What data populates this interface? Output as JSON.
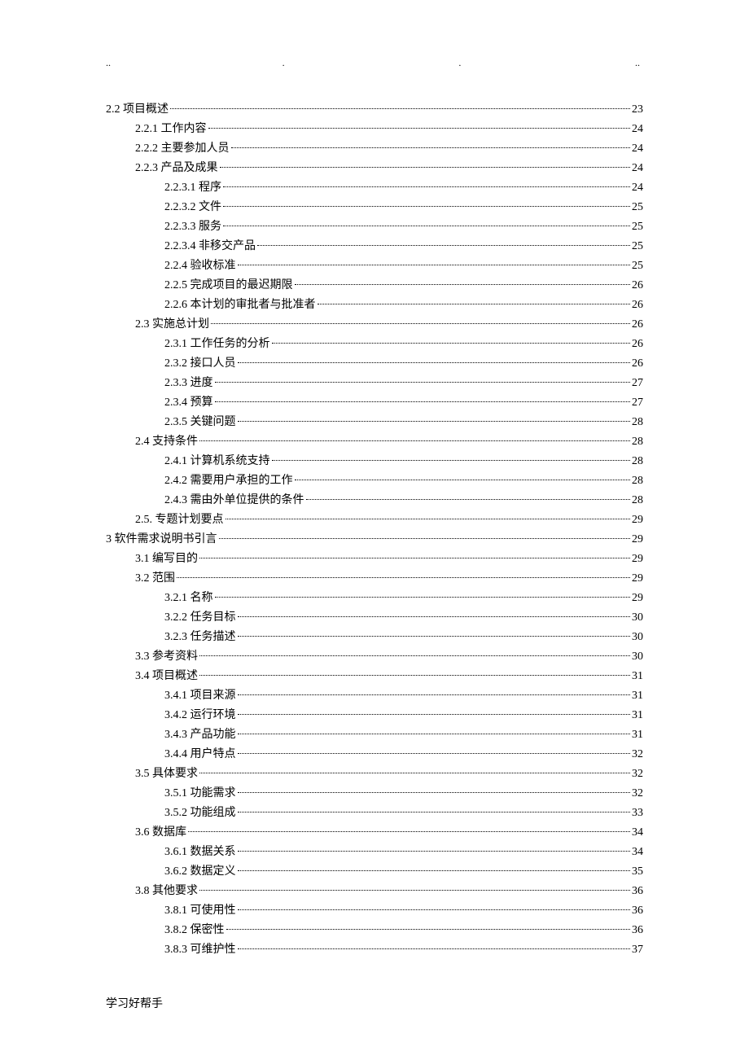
{
  "header_dots": [
    "..",
    ".",
    ".",
    ".."
  ],
  "footer": "学习好帮手",
  "toc": [
    {
      "indent": 0,
      "label": "2.2 项目概述",
      "page": "23"
    },
    {
      "indent": 1,
      "label": "2.2.1 工作内容",
      "page": "24"
    },
    {
      "indent": 1,
      "label": "2.2.2 主要参加人员",
      "page": "24"
    },
    {
      "indent": 1,
      "label": "2.2.3 产品及成果",
      "page": "24"
    },
    {
      "indent": 2,
      "label": "2.2.3.1  程序",
      "page": "24"
    },
    {
      "indent": 2,
      "label": "2.2.3.2  文件",
      "page": "25"
    },
    {
      "indent": 2,
      "label": "2.2.3.3  服务",
      "page": "25"
    },
    {
      "indent": 2,
      "label": "2.2.3.4  非移交产品",
      "page": "25"
    },
    {
      "indent": 2,
      "label": "2.2.4 验收标准",
      "page": "25"
    },
    {
      "indent": 2,
      "label": "2.2.5  完成项目的最迟期限",
      "page": "26"
    },
    {
      "indent": 2,
      "label": "2.2.6  本计划的审批者与批准者",
      "page": "26"
    },
    {
      "indent": 1,
      "label": "2.3 实施总计划",
      "page": "26"
    },
    {
      "indent": 2,
      "label": "2.3.1  工作任务的分析",
      "page": "26"
    },
    {
      "indent": 2,
      "label": "2.3.2  接口人员",
      "page": "26"
    },
    {
      "indent": 2,
      "label": "2.3.3  进度",
      "page": "27"
    },
    {
      "indent": 2,
      "label": "2.3.4  预算",
      "page": "27"
    },
    {
      "indent": 2,
      "label": "2.3.5 关键问题",
      "page": "28"
    },
    {
      "indent": 1,
      "label": "2.4 支持条件",
      "page": "28"
    },
    {
      "indent": 2,
      "label": "2.4.1 计算机系统支持",
      "page": "28"
    },
    {
      "indent": 2,
      "label": "2.4.2  需要用户承担的工作",
      "page": "28"
    },
    {
      "indent": 2,
      "label": "2.4.3  需由外单位提供的条件",
      "page": "28"
    },
    {
      "indent": 1,
      "label": "2.5.  专题计划要点",
      "page": "29"
    },
    {
      "indent": 0,
      "label": "3 软件需求说明书引言",
      "page": "29"
    },
    {
      "indent": 1,
      "label": "3.1 编写目的",
      "page": "29"
    },
    {
      "indent": 1,
      "label": "3.2 范围",
      "page": "29"
    },
    {
      "indent": 2,
      "label": "3.2.1    名称",
      "page": "29"
    },
    {
      "indent": 2,
      "label": "3.2.2    任务目标",
      "page": "30"
    },
    {
      "indent": 2,
      "label": "3.2.3    任务描述",
      "page": "30"
    },
    {
      "indent": 1,
      "label": "3.3 参考资料",
      "page": "30"
    },
    {
      "indent": 1,
      "label": "3.4 项目概述",
      "page": "31"
    },
    {
      "indent": 2,
      "label": "3.4.1 项目来源",
      "page": "31"
    },
    {
      "indent": 2,
      "label": "3.4.2 运行环境",
      "page": "31"
    },
    {
      "indent": 2,
      "label": "3.4.3 产品功能",
      "page": "31"
    },
    {
      "indent": 2,
      "label": "3.4.4 用户特点",
      "page": "32"
    },
    {
      "indent": 1,
      "label": "3.5 具体要求",
      "page": "32"
    },
    {
      "indent": 2,
      "label": "3.5.1 功能需求",
      "page": "32"
    },
    {
      "indent": 2,
      "label": "3.5.2   功能组成",
      "page": "33"
    },
    {
      "indent": 1,
      "label": "3.6 数据库",
      "page": "34"
    },
    {
      "indent": 2,
      "label": "3.6.1   数据关系",
      "page": "34"
    },
    {
      "indent": 2,
      "label": "3.6.2   数据定义",
      "page": "35"
    },
    {
      "indent": 1,
      "label": "3.8 其他要求",
      "page": "36"
    },
    {
      "indent": 2,
      "label": "3.8.1 可使用性",
      "page": "36"
    },
    {
      "indent": 2,
      "label": "3.8.2 保密性",
      "page": "36"
    },
    {
      "indent": 2,
      "label": "3.8.3 可维护性",
      "page": "37"
    }
  ]
}
